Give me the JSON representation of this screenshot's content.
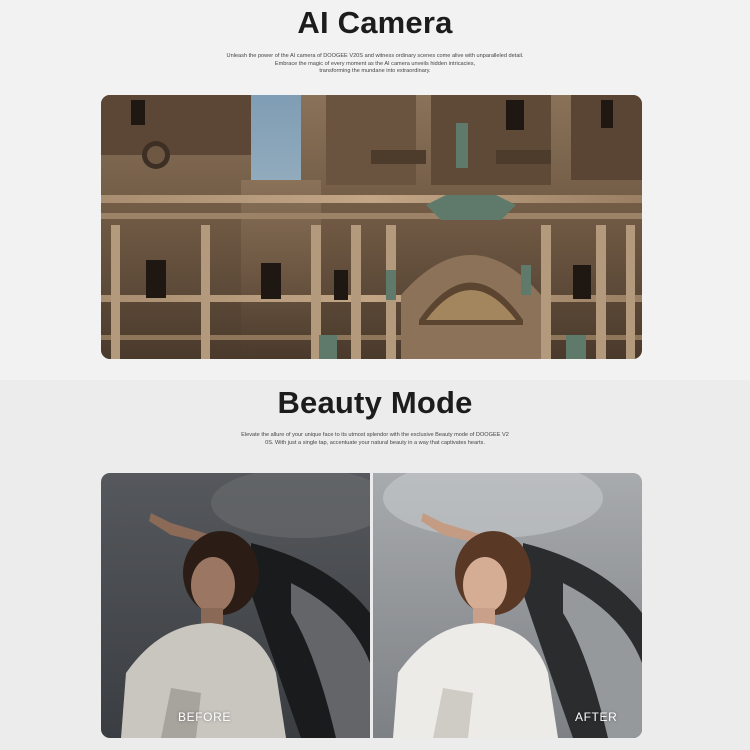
{
  "ai_camera": {
    "title": "AI Camera",
    "description_lines": [
      "Unleash the power of the AI camera of DOOGEE V20S and witness ordinary scenes come alive with unparalleled detail.",
      "Embrace the magic of every moment as the AI camera unveils hidden intricacies,",
      "transforming the mundane into extraordinary."
    ]
  },
  "beauty_mode": {
    "title": "Beauty Mode",
    "description_lines": [
      "Elevate the allure of your unique face to its utmost splendor with the exclusive Beauty mode of DOOGEE V2",
      "0S. With just a single tap, accentuate your natural beauty in a way that captivates hearts."
    ],
    "before_label": "BEFORE",
    "after_label": "AFTER"
  },
  "colors": {
    "background_top": "#f2f2f2",
    "background_bottom": "#ececec",
    "title": "#1c1c1c",
    "label": "#ffffff"
  }
}
